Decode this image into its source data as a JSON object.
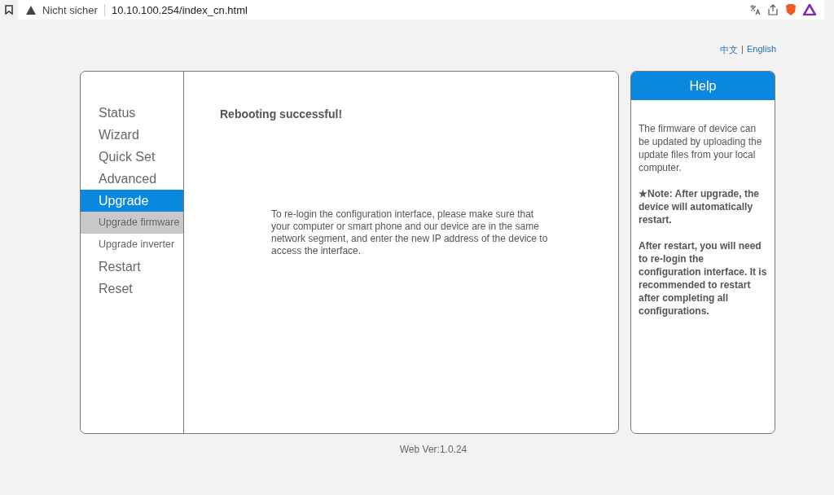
{
  "browser": {
    "security": "Nicht sicher",
    "url": "10.10.100.254/index_cn.html"
  },
  "language": {
    "links": [
      {
        "label": "中文",
        "selected": false
      },
      {
        "label": "English",
        "selected": false
      }
    ],
    "separator": "|"
  },
  "sidebar": {
    "items": [
      {
        "label": "Status",
        "kind": "main",
        "selected": false
      },
      {
        "label": "Wizard",
        "kind": "main",
        "selected": false
      },
      {
        "label": "Quick Set",
        "kind": "main",
        "selected": false
      },
      {
        "label": "Advanced",
        "kind": "main",
        "selected": false
      },
      {
        "label": "Upgrade",
        "kind": "main",
        "selected": true
      },
      {
        "label": "Upgrade firmware",
        "kind": "sub",
        "selected": true
      },
      {
        "label": "Upgrade inverter",
        "kind": "sub",
        "selected": false
      },
      {
        "label": "Restart",
        "kind": "main",
        "selected": false
      },
      {
        "label": "Reset",
        "kind": "main",
        "selected": false
      }
    ]
  },
  "content": {
    "title": "Rebooting successful!",
    "message": "To re-login the configuration interface, please make sure that your computer or smart phone and our device are in the same network segment, and enter the new IP address of the device to access the interface."
  },
  "help": {
    "title": "Help",
    "paragraphs": [
      {
        "text": "The firmware of device can be updated by uploading the update files from your local computer.",
        "kind": "plain"
      },
      {
        "text": "★Note: After upgrade, the device will automatically restart.",
        "kind": "note"
      },
      {
        "text": "After restart, you will need to re-login the configuration interface. It is recommended to restart after completing all configurations.",
        "kind": "note"
      }
    ]
  },
  "footer": {
    "version": "Web Ver:1.0.24"
  }
}
